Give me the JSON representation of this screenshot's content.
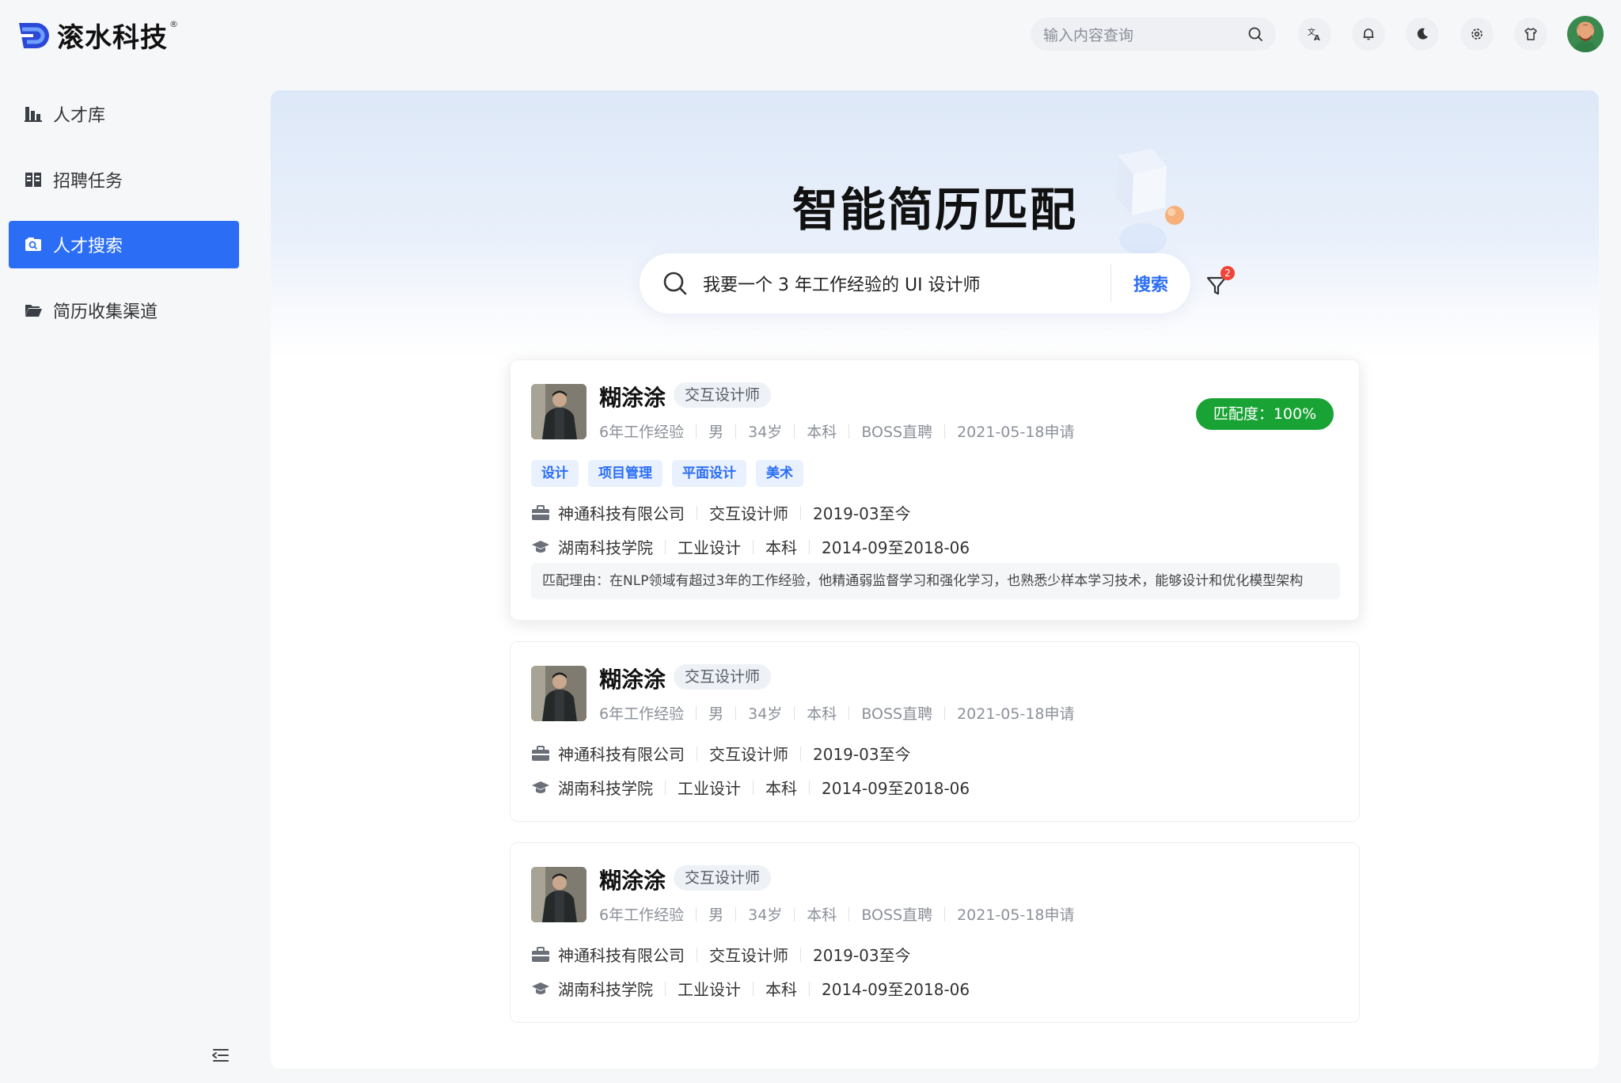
{
  "app": {
    "brand": "滚水科技",
    "brand_mark": "®"
  },
  "topbar": {
    "search_placeholder": "输入内容查询",
    "icons": [
      "search-icon",
      "translate-icon",
      "bell-icon",
      "moon-icon",
      "gear-icon",
      "shirt-icon"
    ]
  },
  "sidebar": {
    "items": [
      {
        "label": "人才库",
        "icon": "chart-bar-icon",
        "active": false
      },
      {
        "label": "招聘任务",
        "icon": "task-list-icon",
        "active": false
      },
      {
        "label": "人才搜索",
        "icon": "search-folder-icon",
        "active": true
      },
      {
        "label": "简历收集渠道",
        "icon": "folder-open-icon",
        "active": false
      }
    ]
  },
  "hero": {
    "title": "智能简历匹配",
    "query": "我要一个 3 年工作经验的 UI 设计师",
    "search_button": "搜索",
    "filter_badge": "2"
  },
  "colors": {
    "accent": "#2b6ef5",
    "match_green": "#1aa335",
    "badge_red": "#f04438"
  },
  "results": [
    {
      "name": "糊涂涂",
      "role": "交互设计师",
      "experience": "6年工作经验",
      "gender": "男",
      "age": "34岁",
      "degree": "本科",
      "source": "BOSS直聘",
      "applied": "2021-05-18申请",
      "match": "匹配度：100%",
      "tags": [
        "设计",
        "项目管理",
        "平面设计",
        "美术"
      ],
      "company": "神通科技有限公司",
      "position": "交互设计师",
      "work_period": "2019-03至今",
      "school": "湖南科技学院",
      "major": "工业设计",
      "edu_degree": "本科",
      "edu_period": "2014-09至2018-06",
      "reason": "匹配理由：在NLP领域有超过3年的工作经验，他精通弱监督学习和强化学习，也熟悉少样本学习技术，能够设计和优化模型架构"
    },
    {
      "name": "糊涂涂",
      "role": "交互设计师",
      "experience": "6年工作经验",
      "gender": "男",
      "age": "34岁",
      "degree": "本科",
      "source": "BOSS直聘",
      "applied": "2021-05-18申请",
      "company": "神通科技有限公司",
      "position": "交互设计师",
      "work_period": "2019-03至今",
      "school": "湖南科技学院",
      "major": "工业设计",
      "edu_degree": "本科",
      "edu_period": "2014-09至2018-06"
    },
    {
      "name": "糊涂涂",
      "role": "交互设计师",
      "experience": "6年工作经验",
      "gender": "男",
      "age": "34岁",
      "degree": "本科",
      "source": "BOSS直聘",
      "applied": "2021-05-18申请",
      "company": "神通科技有限公司",
      "position": "交互设计师",
      "work_period": "2019-03至今",
      "school": "湖南科技学院",
      "major": "工业设计",
      "edu_degree": "本科",
      "edu_period": "2014-09至2018-06"
    }
  ]
}
